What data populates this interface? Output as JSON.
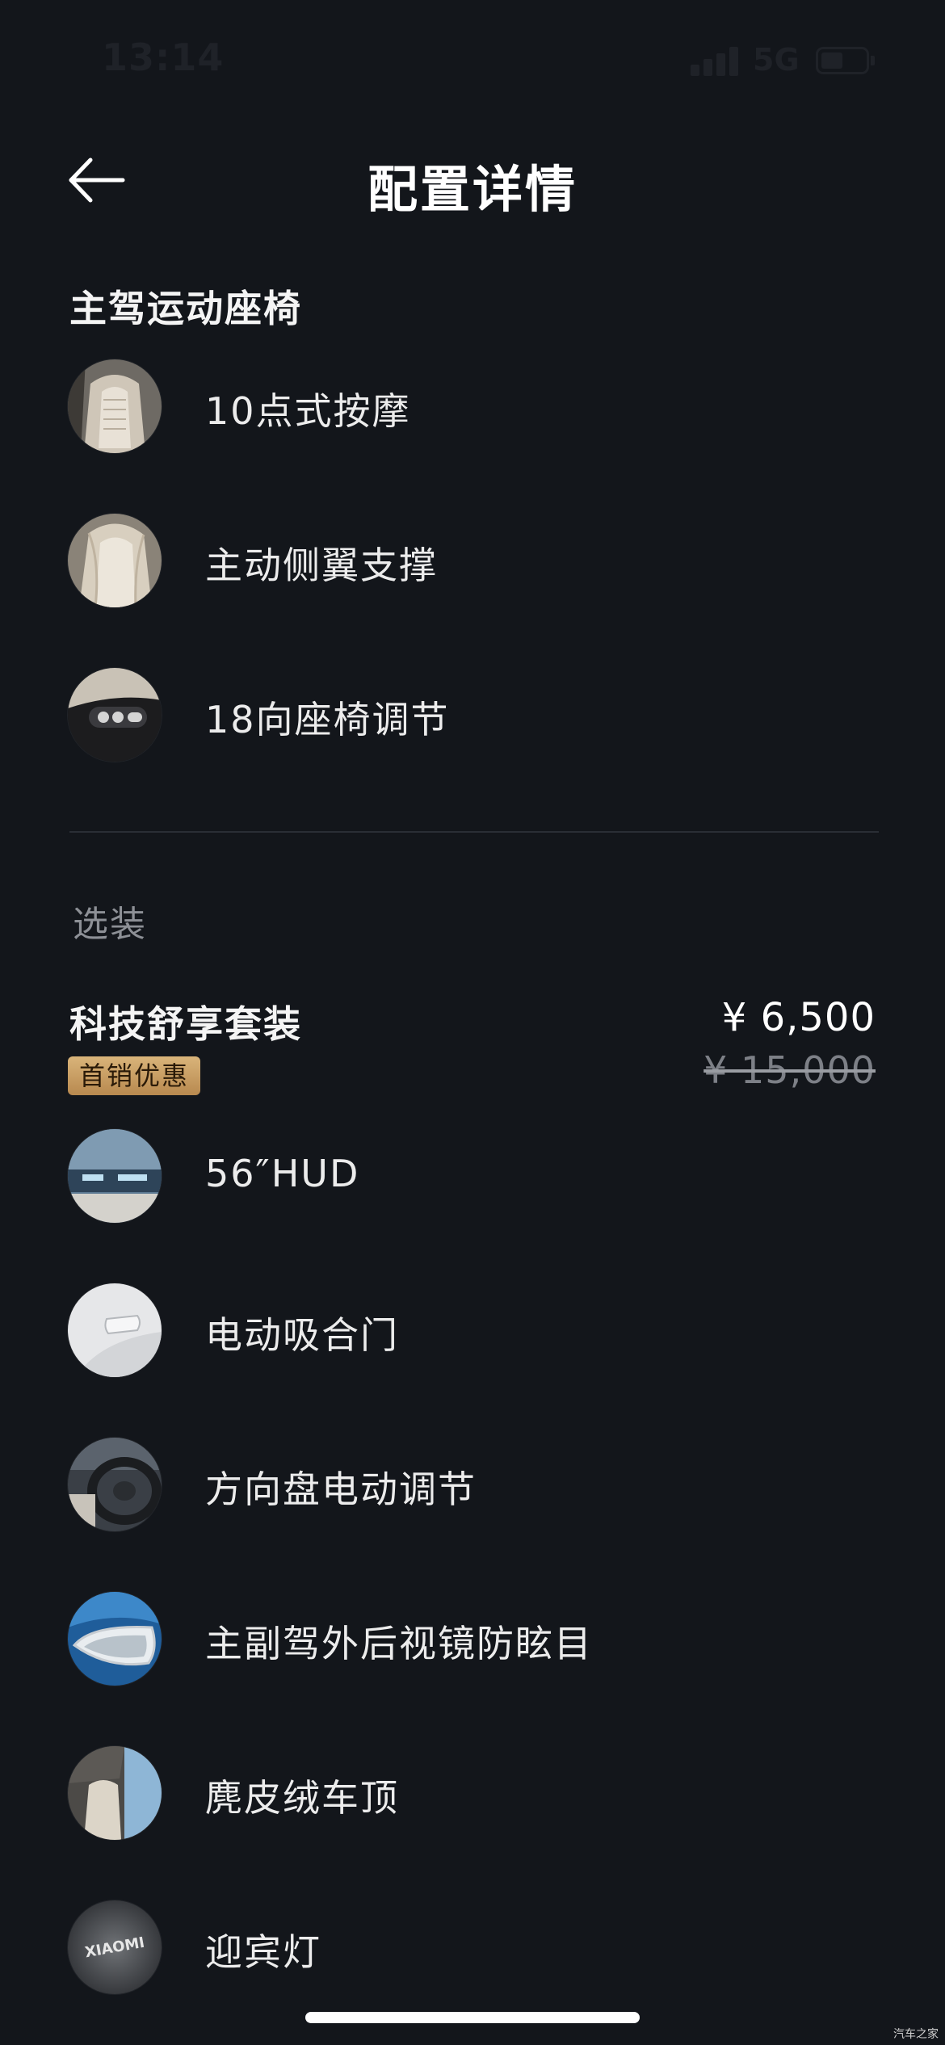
{
  "status_bar": {
    "time": "13:14",
    "network": "5G",
    "battery_level": 0.4
  },
  "header": {
    "title": "配置详情"
  },
  "seat_section": {
    "title": "主驾运动座椅",
    "items": [
      {
        "label": "10点式按摩",
        "icon": "seat-massage-thumbnail"
      },
      {
        "label": "主动侧翼支撑",
        "icon": "seat-bolster-thumbnail"
      },
      {
        "label": "18向座椅调节",
        "icon": "seat-controls-thumbnail"
      }
    ]
  },
  "options_section": {
    "title": "选装",
    "package": {
      "name": "科技舒享套装",
      "badge": "首销优惠",
      "price": "¥ 6,500",
      "original_price": "¥ 15,000",
      "items": [
        {
          "label": "56″HUD",
          "icon": "hud-thumbnail"
        },
        {
          "label": "电动吸合门",
          "icon": "door-handle-thumbnail"
        },
        {
          "label": "方向盘电动调节",
          "icon": "steering-wheel-thumbnail"
        },
        {
          "label": "主副驾外后视镜防眩目",
          "icon": "side-mirror-thumbnail"
        },
        {
          "label": "麂皮绒车顶",
          "icon": "suede-headliner-thumbnail"
        },
        {
          "label": "迎宾灯",
          "icon": "welcome-light-thumbnail",
          "logo_text": "XIAOMI"
        }
      ]
    }
  },
  "watermark": "汽车之家"
}
